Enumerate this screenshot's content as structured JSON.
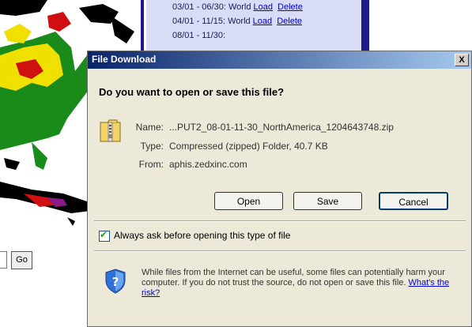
{
  "background": {
    "panel_lines": [
      {
        "text": "03/01 - 06/30: World",
        "load": "Load",
        "delete": "Delete"
      },
      {
        "text": "04/01 - 11/15: World",
        "load": "Load",
        "delete": "Delete"
      },
      {
        "text": "08/01 - 11/30:",
        "load": "",
        "delete": ""
      }
    ],
    "go_button": "Go"
  },
  "dialog": {
    "title": "File Download",
    "close_label": "X",
    "question": "Do you want to open or save this file?",
    "info": {
      "name_label": "Name:",
      "name_value": "...PUT2_08-01-11-30_NorthAmerica_1204643748.zip",
      "type_label": "Type:",
      "type_value": "Compressed (zipped) Folder, 40.7 KB",
      "from_label": "From:",
      "from_value": "aphis.zedxinc.com"
    },
    "buttons": {
      "open": "Open",
      "save": "Save",
      "cancel": "Cancel"
    },
    "checkbox": {
      "label": "Always ask before opening this type of file",
      "checked": true
    },
    "warning": {
      "text": "While files from the Internet can be useful, some files can potentially harm your computer. If you do not trust the source, do not open or save this file.",
      "link": "What's the risk?"
    }
  },
  "icons": {
    "file": "zip-folder-icon",
    "shield": "security-shield-icon",
    "close": "close-icon"
  },
  "colors": {
    "titlebar_start": "#0a246a",
    "titlebar_end": "#a6caf0",
    "dialog_bg": "#ece9d8",
    "panel_bg": "#d8dcf6",
    "link": "#0000cc"
  }
}
